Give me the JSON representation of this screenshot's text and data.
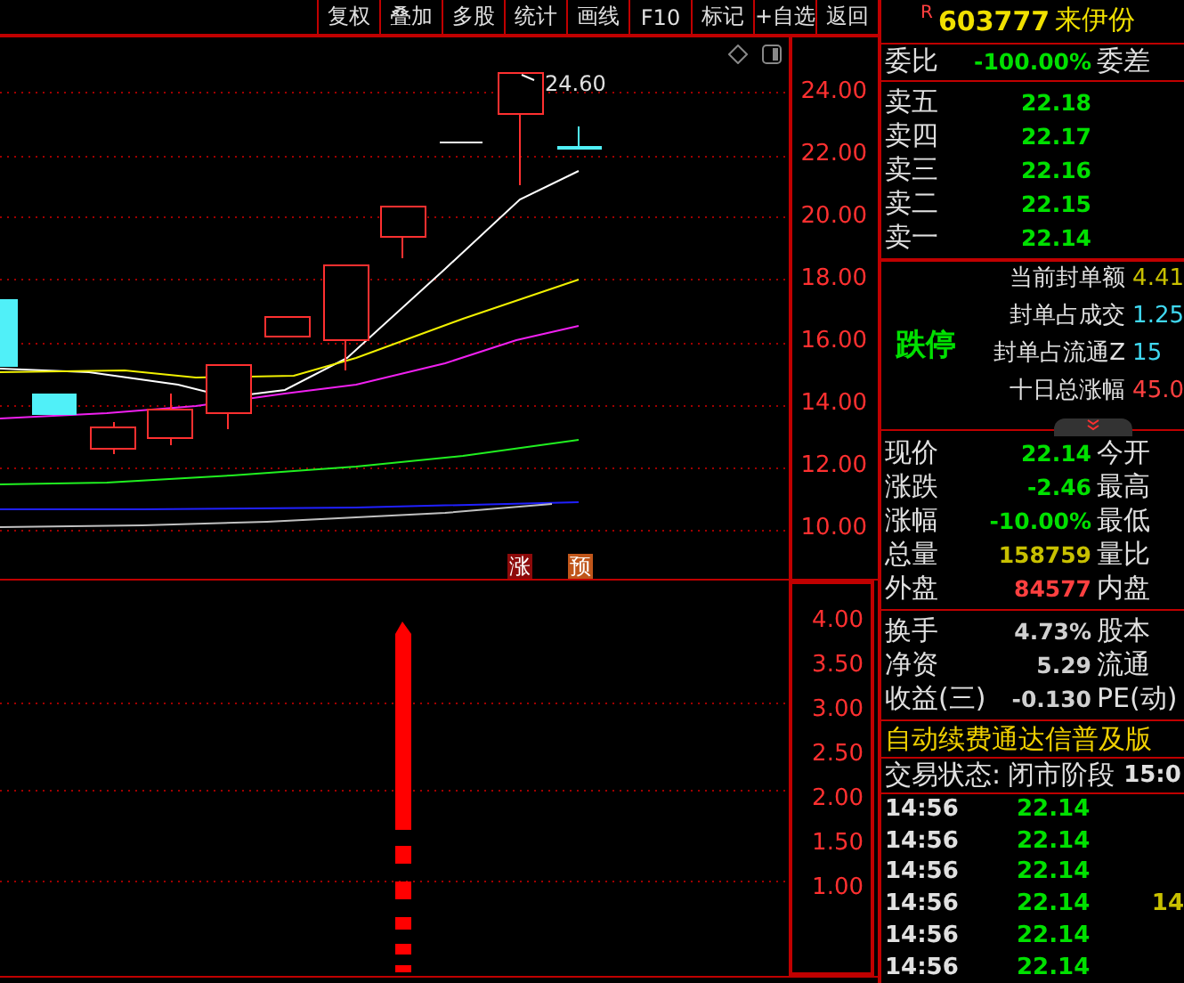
{
  "toolbar": {
    "buttons": [
      "复权",
      "叠加",
      "多股",
      "统计",
      "画线",
      "F10",
      "标记",
      "+自选",
      "返回"
    ]
  },
  "price_chart": {
    "high_label": "24.60",
    "axis_labels": [
      "24.00",
      "22.00",
      "20.00",
      "18.00",
      "16.00",
      "14.00",
      "12.00",
      "10.00"
    ],
    "badges": [
      {
        "text": "涨",
        "color": "#8c0a0a"
      },
      {
        "text": "预",
        "color": "#c0561a"
      }
    ]
  },
  "indicator_chart": {
    "axis_labels": [
      "4.00",
      "3.50",
      "3.00",
      "2.50",
      "2.00",
      "1.50",
      "1.00"
    ]
  },
  "quote": {
    "flag": "R",
    "code": "603777",
    "name": "来伊份"
  },
  "order_ratio": {
    "label": "委比",
    "value": "-100.00%",
    "label2": "委差"
  },
  "asks": [
    {
      "label": "卖五",
      "price": "22.18"
    },
    {
      "label": "卖四",
      "price": "22.17"
    },
    {
      "label": "卖三",
      "price": "22.16"
    },
    {
      "label": "卖二",
      "price": "22.15"
    },
    {
      "label": "卖一",
      "price": "22.14"
    }
  ],
  "limit": {
    "status": "跌停",
    "rows": [
      {
        "label": "当前封单额",
        "value": "4.41",
        "color": "#c8c000"
      },
      {
        "label": "封单占成交",
        "value": "1.25",
        "color": "#40d8f0"
      },
      {
        "label": "封单占流通Z",
        "value": "15",
        "color": "#40d8f0"
      },
      {
        "label": "十日总涨幅",
        "value": "45.0",
        "color": "#ff4040"
      }
    ]
  },
  "stats": [
    {
      "label": "现价",
      "value": "22.14",
      "label2": "今开",
      "color": "#00e000"
    },
    {
      "label": "涨跌",
      "value": "-2.46",
      "label2": "最高",
      "color": "#00e000"
    },
    {
      "label": "涨幅",
      "value": "-10.00%",
      "label2": "最低",
      "color": "#00e000"
    },
    {
      "label": "总量",
      "value": "158759",
      "label2": "量比",
      "color": "#c8c000"
    },
    {
      "label": "外盘",
      "value": "84577",
      "label2": "内盘",
      "color": "#ff4040"
    }
  ],
  "fundamentals": [
    {
      "label": "换手",
      "value": "4.73%",
      "label2": "股本"
    },
    {
      "label": "净资",
      "value": "5.29",
      "label2": "流通"
    },
    {
      "label": "收益(三)",
      "value": "-0.130",
      "label2": "PE(动)"
    }
  ],
  "banner": "自动续费通达信普及版",
  "trade_status": {
    "label": "交易状态:",
    "value": "闭市阶段",
    "time": "15:0"
  },
  "ticks": [
    {
      "time": "14:56",
      "price": "22.14"
    },
    {
      "time": "14:56",
      "price": "22.14"
    },
    {
      "time": "14:56",
      "price": "22.14"
    },
    {
      "time": "14:56",
      "price": "22.14",
      "volume": "14"
    },
    {
      "time": "14:56",
      "price": "22.14"
    },
    {
      "time": "14:56",
      "price": "22.14"
    }
  ]
}
